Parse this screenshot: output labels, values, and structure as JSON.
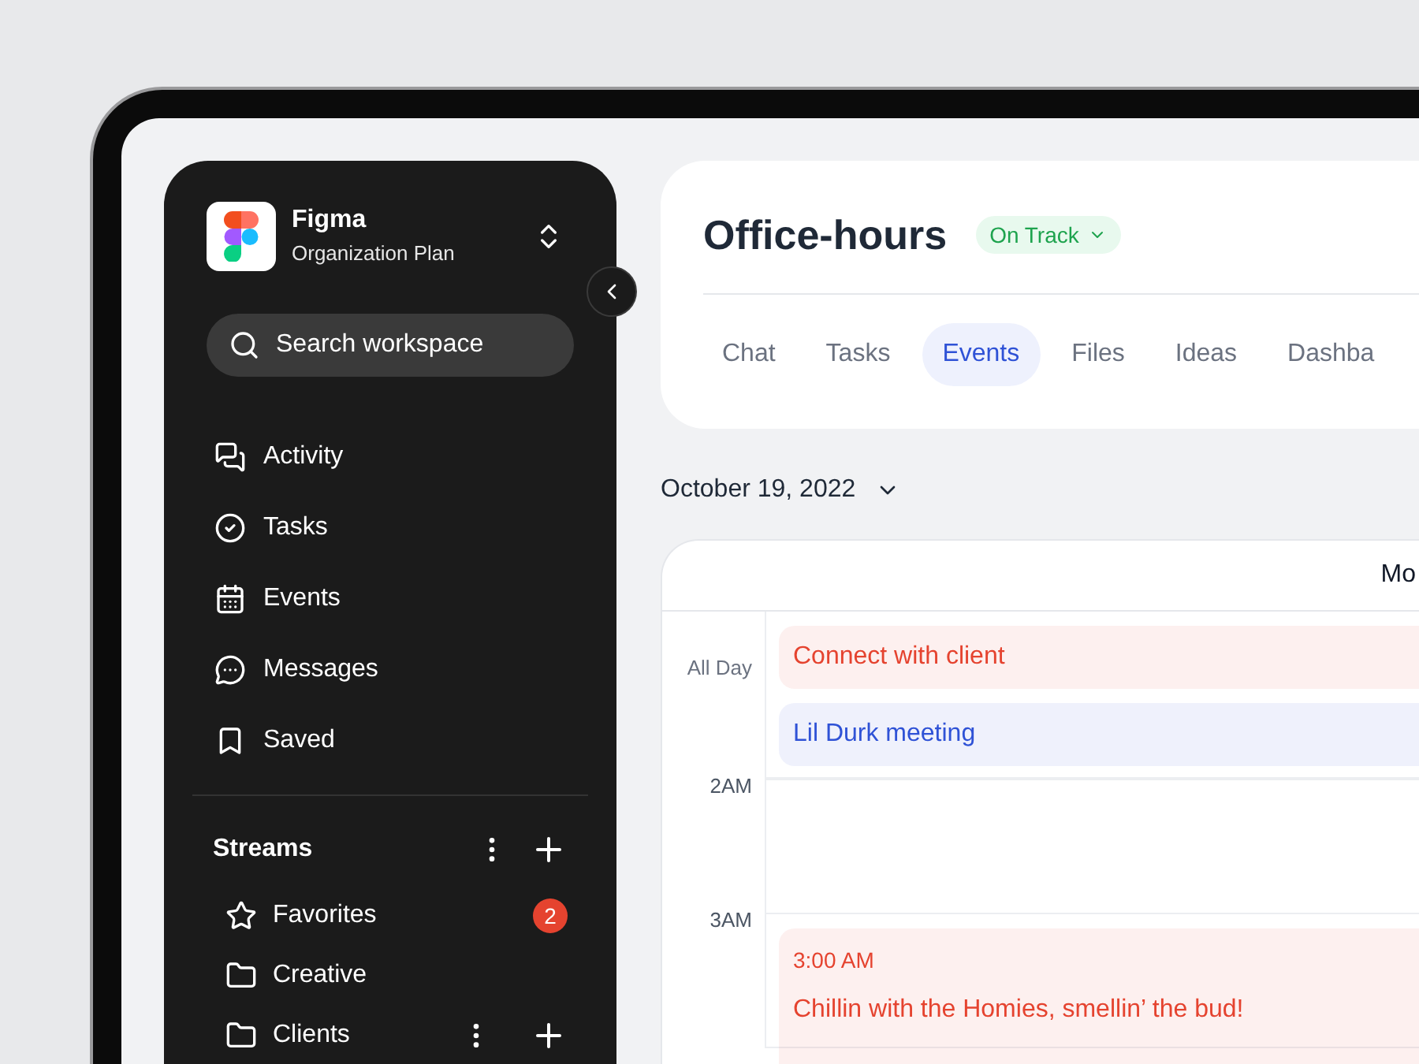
{
  "workspace": {
    "name": "Figma",
    "plan": "Organization Plan"
  },
  "search": {
    "placeholder": "Search workspace"
  },
  "nav": [
    {
      "label": "Activity",
      "kind": "activity"
    },
    {
      "label": "Tasks",
      "kind": "tasks"
    },
    {
      "label": "Events",
      "kind": "events"
    },
    {
      "label": "Messages",
      "kind": "messages"
    },
    {
      "label": "Saved",
      "kind": "saved"
    }
  ],
  "streams": {
    "title": "Streams",
    "items": [
      {
        "label": "Favorites",
        "kind": "starred",
        "badge": "2"
      },
      {
        "label": "Creative",
        "kind": "folder"
      },
      {
        "label": "Clients",
        "kind": "group"
      }
    ]
  },
  "page": {
    "title": "Office-hours",
    "status": "On Track"
  },
  "tabs": [
    {
      "label": "Chat",
      "selected": false
    },
    {
      "label": "Tasks",
      "selected": false
    },
    {
      "label": "Events",
      "selected": true
    },
    {
      "label": "Files",
      "selected": false
    },
    {
      "label": "Ideas",
      "selected": false
    },
    {
      "label": "Dashba",
      "selected": false
    }
  ],
  "date": "October 19, 2022",
  "calendar": {
    "day_header": "Mo",
    "all_day_label": "All Day",
    "all_day_events": [
      {
        "title": "Connect with client",
        "color": "#e5432f"
      },
      {
        "title": "Lil Durk meeting",
        "color": "#2f52d6"
      }
    ],
    "hours": [
      {
        "label": "2AM"
      },
      {
        "label": "3AM",
        "event": {
          "time": "3:00 AM",
          "title": "Chillin with the Homies, smellin’ the bud!",
          "color": "#e5432f"
        }
      }
    ]
  }
}
